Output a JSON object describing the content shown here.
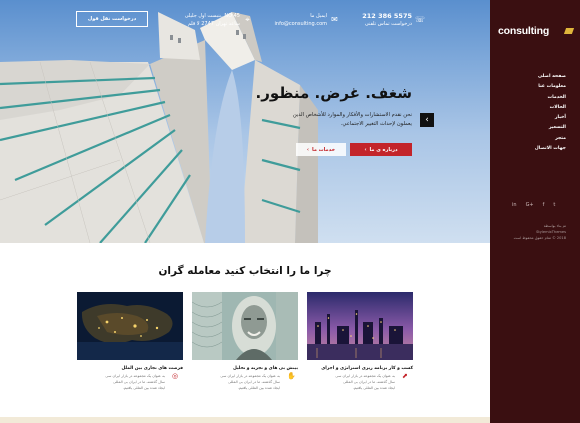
{
  "topbar": {
    "quote_button": "درخواست نقل قول",
    "address_line1": "NO 45 ,بنبست اول جلیلی",
    "address_line2": "ساعد تهران 2747 لا قلم",
    "email_line1": "ایمیل ما",
    "email_line2": "info@consulting.com",
    "phone_number": "5575 386 212",
    "phone_line2": "درخواست تماس تلفنی"
  },
  "hero": {
    "headline": "شغف. غرض. منظور.",
    "subtext_line1": "نحن نقدم الاستشارات والأفكار والموارد للأشخاص الذين",
    "subtext_line2": "يعملون لإحداث التغيير الاجتماعي.",
    "primary_button": "درباره ی ما",
    "secondary_button": "خدمات ما",
    "arrow": "‹"
  },
  "sidebar": {
    "logo": "consulting",
    "nav": [
      "صفحه اصلی",
      "معلومات عنا",
      "الخدمات",
      "الحالات",
      "أخبار",
      "التسعير",
      "متجر",
      "جهات الاتصال"
    ],
    "socials": [
      "in",
      "G+",
      "f",
      "t"
    ],
    "copyright_line1": "تم بناء بواسطة",
    "copyright_line2": "StylemixThemes",
    "copyright_line3": "2018 © تمام حقوق محفوظ است"
  },
  "section": {
    "title": "چرا ما را انتخاب کنید معامله گران"
  },
  "cards": [
    {
      "title": "فرصت های تجاری بین الملل",
      "text_line1": "به عنوان یک مجموعه در بازار ایران سی",
      "text_line2": "سال گذشته، ما در ایران بی المللی",
      "text_line3": "ایجاد شده بین المللی یافتیم."
    },
    {
      "title": "بینش بی های و تجربه و تحلیل",
      "text_line1": "به عنوان یک مجموعه در بازار ایران سی",
      "text_line2": "سال گذشته، ما در ایران بی المللی",
      "text_line3": "ایجاد شده بین المللی یافتیم."
    },
    {
      "title": "کسب و کار برنامه ریزی استراتژی و اجرای",
      "text_line1": "به عنوان یک مجموعه در بازار ایران سی",
      "text_line2": "سال گذشته، ما در ایران بی المللی",
      "text_line3": "ایجاد شده بین المللی یافتیم."
    }
  ],
  "colors": {
    "accent": "#c3242a",
    "sidebar_bg": "#3a0f11",
    "logo_mark": "#e0b63b"
  }
}
